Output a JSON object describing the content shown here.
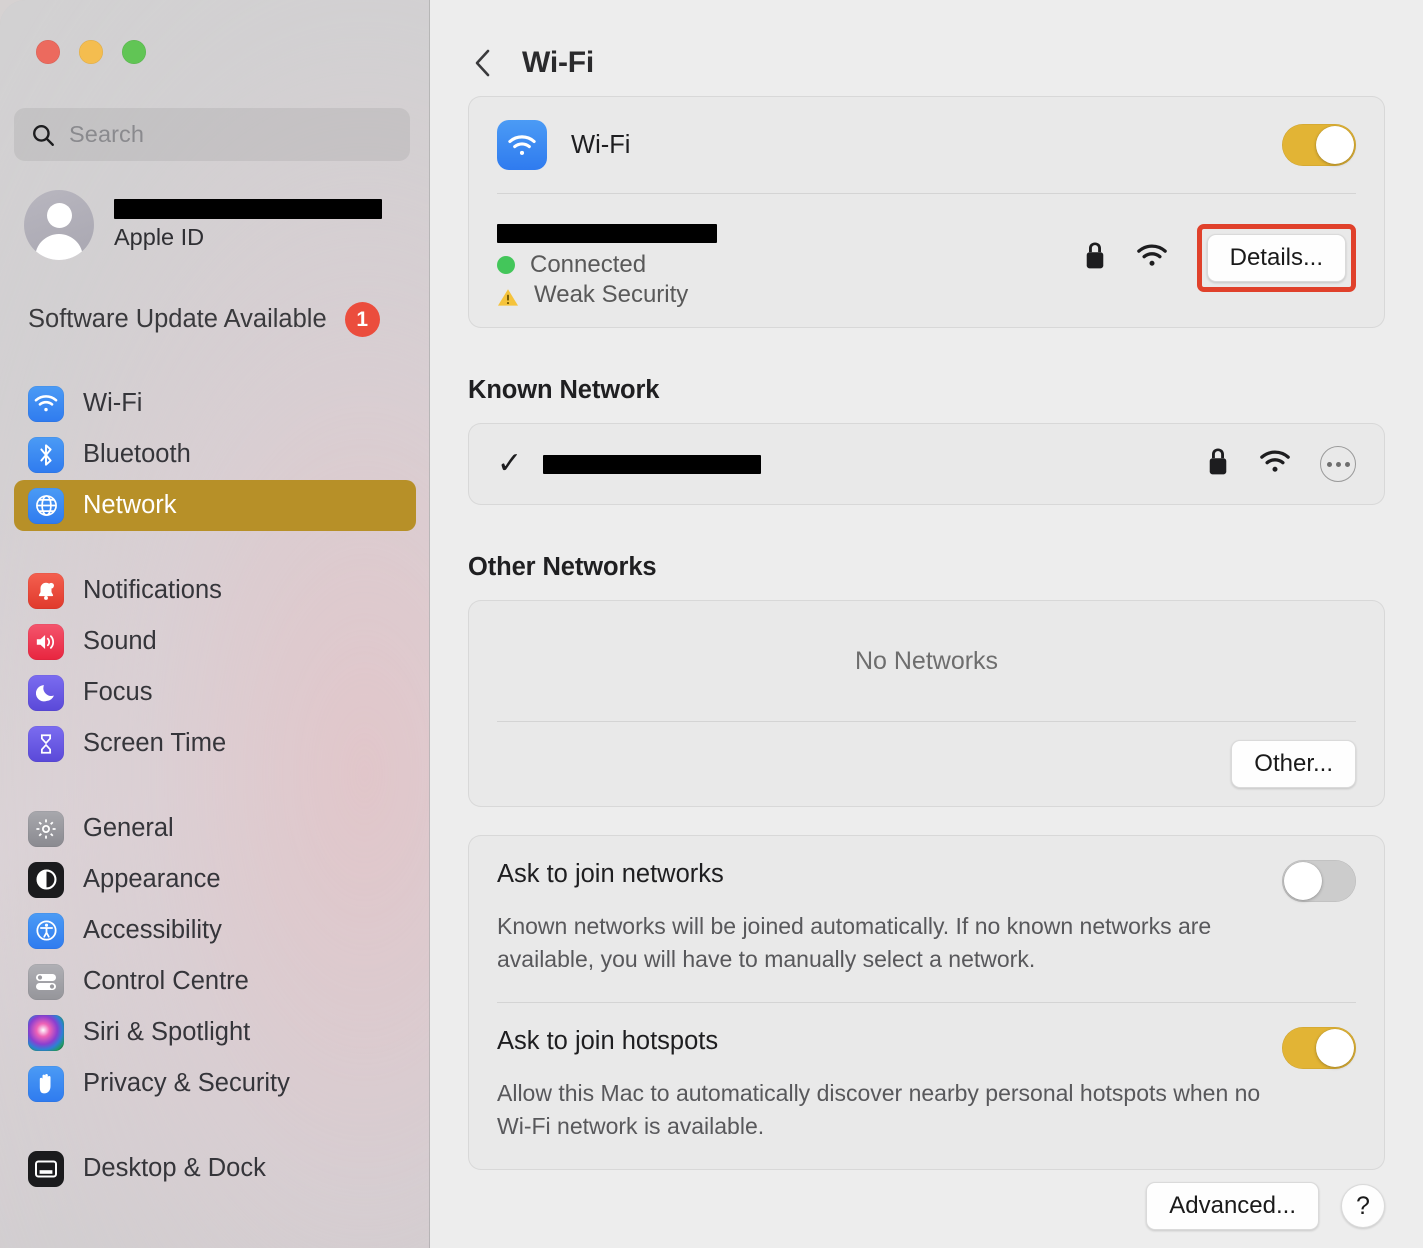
{
  "window": {
    "traffic_lights": [
      "close",
      "minimize",
      "zoom"
    ]
  },
  "sidebar": {
    "search": {
      "placeholder": "Search",
      "value": "",
      "icon": "search-icon"
    },
    "account": {
      "name_redacted": true,
      "subtitle": "Apple ID",
      "avatar_icon": "person-avatar-icon"
    },
    "update": {
      "label": "Software Update Available",
      "badge": "1",
      "badge_color": "#eb4d3d"
    },
    "selected_item": "Network",
    "selected_color": "#b79028",
    "groups": [
      {
        "items": [
          {
            "label": "Wi-Fi",
            "icon": "wifi-icon",
            "color": "#3b8ef3"
          },
          {
            "label": "Bluetooth",
            "icon": "bluetooth-icon",
            "color": "#3b8ef3"
          },
          {
            "label": "Network",
            "icon": "globe-icon",
            "color": "#3b8ef3",
            "selected": true
          }
        ]
      },
      {
        "items": [
          {
            "label": "Notifications",
            "icon": "bell-icon",
            "color": "#ea4b3c"
          },
          {
            "label": "Sound",
            "icon": "speaker-icon",
            "color": "#ee3f5c"
          },
          {
            "label": "Focus",
            "icon": "moon-icon",
            "color": "#6b5ce7"
          },
          {
            "label": "Screen Time",
            "icon": "hourglass-icon",
            "color": "#6b5ce7"
          }
        ]
      },
      {
        "items": [
          {
            "label": "General",
            "icon": "gear-icon",
            "color": "#8e8e93"
          },
          {
            "label": "Appearance",
            "icon": "appearance-contrast-icon",
            "color": "#1c1c1e"
          },
          {
            "label": "Accessibility",
            "icon": "accessibility-icon",
            "color": "#2f7bef"
          },
          {
            "label": "Control Centre",
            "icon": "control-centre-icon",
            "color": "#9a9a9f"
          },
          {
            "label": "Siri & Spotlight",
            "icon": "siri-icon",
            "color": "#2a1030"
          },
          {
            "label": "Privacy & Security",
            "icon": "hand-icon",
            "color": "#2f7bef"
          }
        ]
      },
      {
        "items": [
          {
            "label": "Desktop & Dock",
            "icon": "desktop-dock-icon",
            "color": "#1c1c1e"
          }
        ]
      }
    ]
  },
  "main": {
    "back_icon": "chevron-left-icon",
    "title": "Wi-Fi",
    "wifi_toggle": {
      "label": "Wi-Fi",
      "icon": "wifi-icon",
      "state": "on",
      "on_color": "#e2b435"
    },
    "connected_network": {
      "ssid_redacted": true,
      "status": "Connected",
      "status_dot_color": "#43c65a",
      "security_warning": "Weak Security",
      "warning_color": "#f5c33b",
      "lock_icon": "lock-icon",
      "signal_icon": "wifi-signal-icon",
      "details_button": "Details...",
      "highlight_color": "#e0412b"
    },
    "known_network": {
      "section_title": "Known Network",
      "check_icon": "checkmark-icon",
      "ssid_redacted": true,
      "lock_icon": "lock-icon",
      "signal_icon": "wifi-signal-icon",
      "more_button_icon": "ellipsis-circle-icon"
    },
    "other_networks": {
      "section_title": "Other Networks",
      "empty_text": "No Networks",
      "other_button": "Other..."
    },
    "preferences": [
      {
        "title": "Ask to join networks",
        "description": "Known networks will be joined automatically. If no known networks are available, you will have to manually select a network.",
        "toggle_state": "off"
      },
      {
        "title": "Ask to join hotspots",
        "description": "Allow this Mac to automatically discover nearby personal hotspots when no Wi-Fi network is available.",
        "toggle_state": "on"
      }
    ],
    "footer": {
      "advanced_button": "Advanced...",
      "help_button": "?"
    }
  }
}
